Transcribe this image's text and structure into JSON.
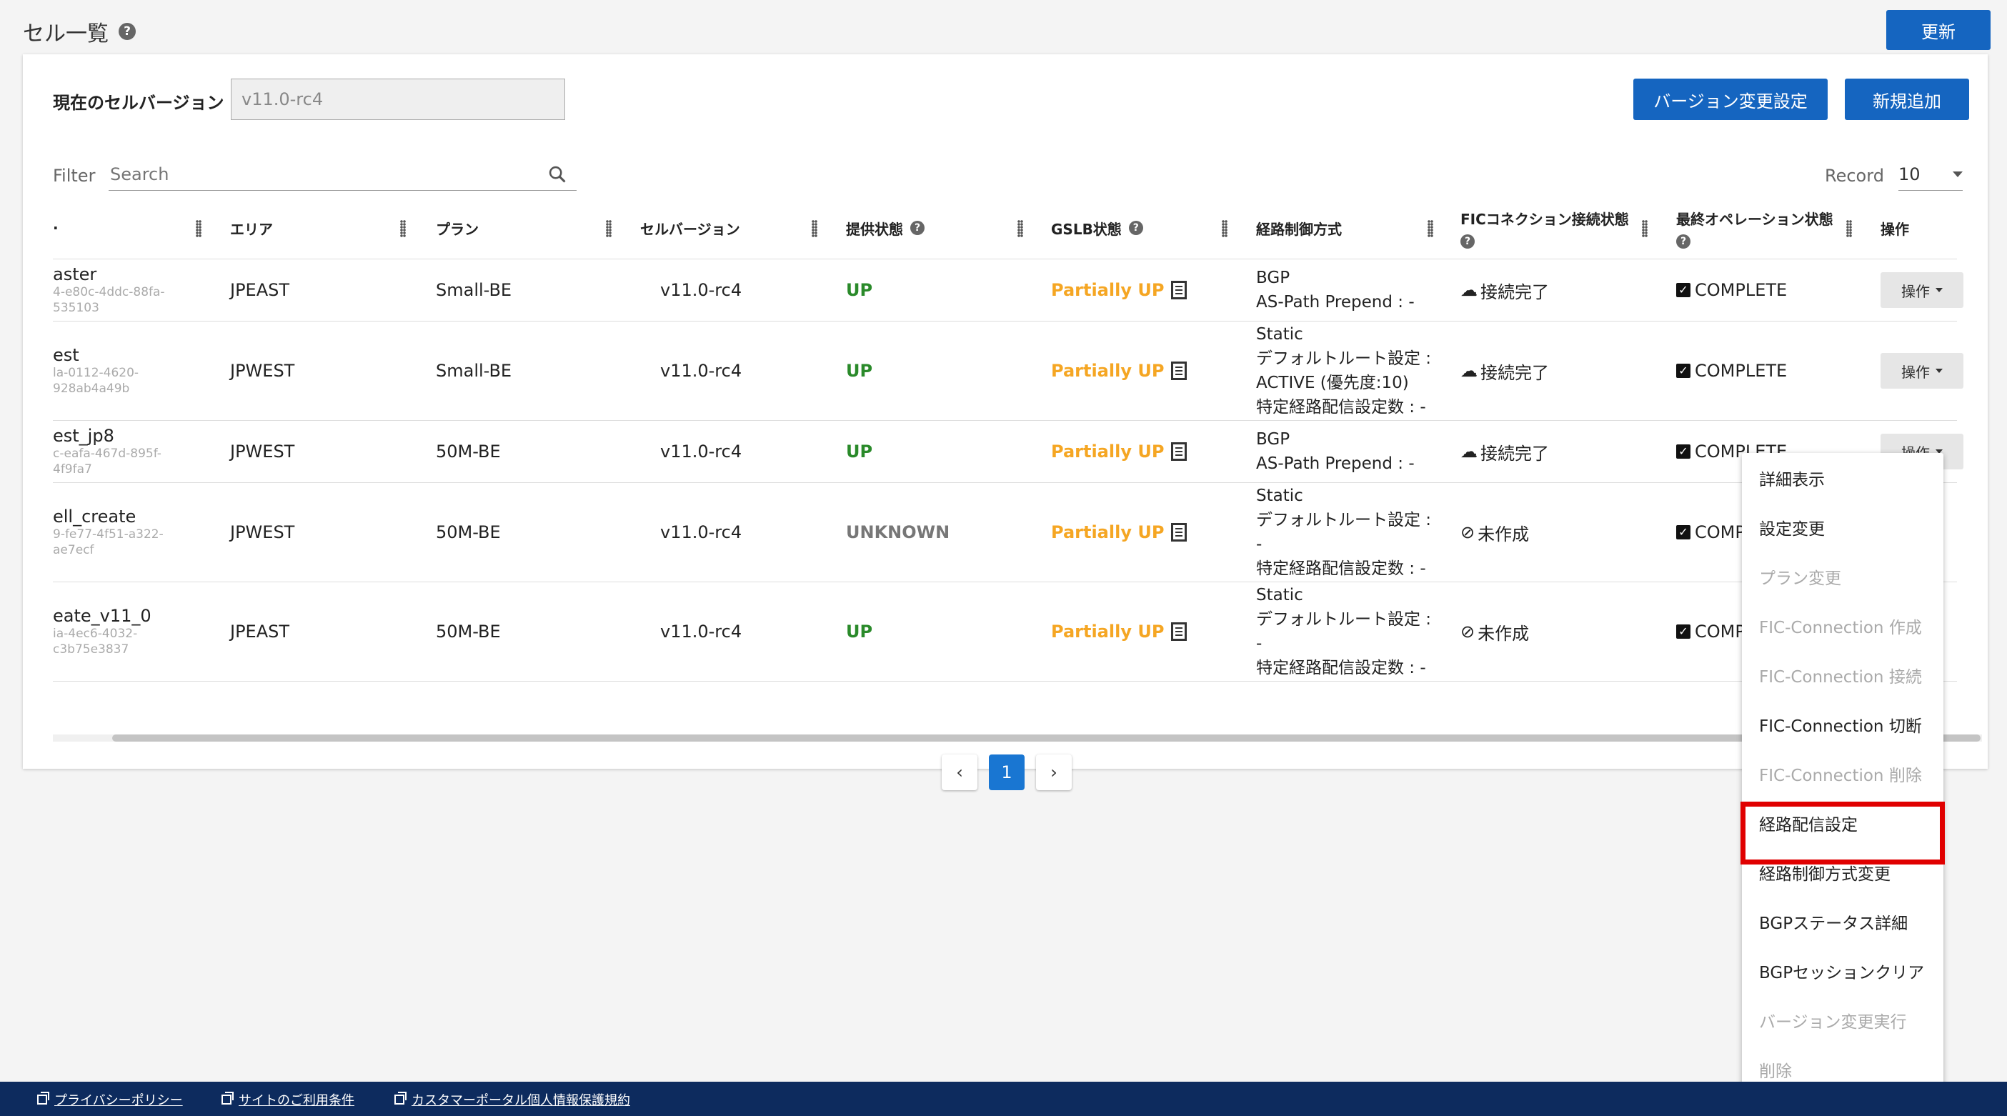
{
  "page": {
    "title": "セル一覧"
  },
  "header": {
    "refresh_label": "更新"
  },
  "version": {
    "label": "現在のセルバージョン",
    "placeholder": "v11.0-rc4"
  },
  "actions": {
    "version_change": "バージョン変更設定",
    "add_new": "新規追加"
  },
  "filter": {
    "label": "Filter",
    "placeholder": "Search"
  },
  "record": {
    "label": "Record",
    "value": "10"
  },
  "columns": {
    "area": "エリア",
    "plan": "プラン",
    "cell_version": "セルバージョン",
    "provide_status": "提供状態",
    "gslb_status": "GSLB状態",
    "route_control": "経路制御方式",
    "fic_status": "FICコネクション接続状態",
    "last_op_status": "最終オペレーション状態",
    "operation": "操作"
  },
  "rows": [
    {
      "name": "aster",
      "id1": "4-e80c-4ddc-88fa-",
      "id2": "535103",
      "area": "JPEAST",
      "plan": "Small-BE",
      "version": "v11.0-rc4",
      "status": "UP",
      "gslb": "Partially UP",
      "route1": "BGP",
      "route2": "AS-Path Prepend : -",
      "route3": "",
      "route4": "",
      "fic_icon": "☁",
      "fic": "接続完了",
      "last": "COMPLETE",
      "op": "操作"
    },
    {
      "name": "est",
      "id1": "la-0112-4620-",
      "id2": "928ab4a49b",
      "area": "JPWEST",
      "plan": "Small-BE",
      "version": "v11.0-rc4",
      "status": "UP",
      "gslb": "Partially UP",
      "route1": "Static",
      "route2": "デフォルトルート設定 :",
      "route3": "ACTIVE (優先度:10)",
      "route4": "特定経路配信設定数 : -",
      "fic_icon": "☁",
      "fic": "接続完了",
      "last": "COMPLETE",
      "op": "操作"
    },
    {
      "name": "est_jp8",
      "id1": "c-eafa-467d-895f-",
      "id2": "4f9fa7",
      "area": "JPWEST",
      "plan": "50M-BE",
      "version": "v11.0-rc4",
      "status": "UP",
      "gslb": "Partially UP",
      "route1": "BGP",
      "route2": "AS-Path Prepend : -",
      "route3": "",
      "route4": "",
      "fic_icon": "☁",
      "fic": "接続完了",
      "last": "COMPLETE",
      "op": "操作"
    },
    {
      "name": "ell_create",
      "id1": "9-fe77-4f51-a322-",
      "id2": "ae7ecf",
      "area": "JPWEST",
      "plan": "50M-BE",
      "version": "v11.0-rc4",
      "status": "UNKNOWN",
      "gslb": "Partially UP",
      "route1": "Static",
      "route2": "デフォルトルート設定 :",
      "route3": "-",
      "route4": "特定経路配信設定数 : -",
      "fic_icon": "⊘",
      "fic": "未作成",
      "last": "COMPLE",
      "op": ""
    },
    {
      "name": "eate_v11_0",
      "id1": "ia-4ec6-4032-",
      "id2": "c3b75e3837",
      "area": "JPEAST",
      "plan": "50M-BE",
      "version": "v11.0-rc4",
      "status": "UP",
      "gslb": "Partially UP",
      "route1": "Static",
      "route2": "デフォルトルート設定 :",
      "route3": "-",
      "route4": "特定経路配信設定数 : -",
      "fic_icon": "⊘",
      "fic": "未作成",
      "last": "COMPLE",
      "op": ""
    }
  ],
  "pagination": {
    "prev": "‹",
    "current": "1",
    "next": "›"
  },
  "menu": [
    {
      "label": "詳細表示",
      "enabled": true
    },
    {
      "label": "設定変更",
      "enabled": true
    },
    {
      "label": "プラン変更",
      "enabled": false
    },
    {
      "label": "FIC-Connection 作成",
      "enabled": false
    },
    {
      "label": "FIC-Connection 接続",
      "enabled": false
    },
    {
      "label": "FIC-Connection 切断",
      "enabled": true
    },
    {
      "label": "FIC-Connection 削除",
      "enabled": false
    },
    {
      "label": "経路配信設定",
      "enabled": true
    },
    {
      "label": "経路制御方式変更",
      "enabled": true
    },
    {
      "label": "BGPステータス詳細",
      "enabled": true
    },
    {
      "label": "BGPセッションクリア",
      "enabled": true
    },
    {
      "label": "バージョン変更実行",
      "enabled": false
    },
    {
      "label": "削除",
      "enabled": false
    }
  ],
  "footer": {
    "privacy": "プライバシーポリシー",
    "terms": "サイトのご利用条件",
    "portal": "カスタマーポータル個人情報保護規約"
  },
  "colors": {
    "primary": "#1565c0",
    "up": "#2a8a2a",
    "partial": "#f5a623",
    "footer": "#0d2b5e",
    "highlight": "#e00000"
  }
}
